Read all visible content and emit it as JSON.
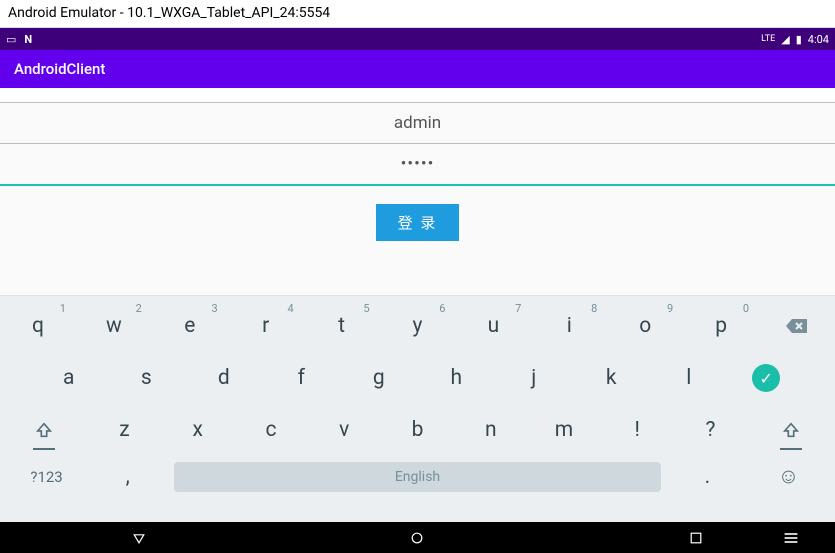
{
  "window": {
    "title": "Android Emulator - 10.1_WXGA_Tablet_API_24:5554"
  },
  "status": {
    "left_icons": [
      "card-icon",
      "n-icon"
    ],
    "right": {
      "signal": "LTE",
      "battery": "▮",
      "time": "4:04"
    }
  },
  "actionbar": {
    "title": "AndroidClient"
  },
  "form": {
    "username": {
      "value": "admin",
      "placeholder": ""
    },
    "password": {
      "value": "•••••",
      "placeholder": ""
    },
    "login_label": "登 录"
  },
  "keyboard": {
    "row1": [
      {
        "main": "q",
        "sup": "1"
      },
      {
        "main": "w",
        "sup": "2"
      },
      {
        "main": "e",
        "sup": "3"
      },
      {
        "main": "r",
        "sup": "4"
      },
      {
        "main": "t",
        "sup": "5"
      },
      {
        "main": "y",
        "sup": "6"
      },
      {
        "main": "u",
        "sup": "7"
      },
      {
        "main": "i",
        "sup": "8"
      },
      {
        "main": "o",
        "sup": "9"
      },
      {
        "main": "p",
        "sup": "0"
      }
    ],
    "row2": [
      {
        "main": "a"
      },
      {
        "main": "s"
      },
      {
        "main": "d"
      },
      {
        "main": "f"
      },
      {
        "main": "g"
      },
      {
        "main": "h"
      },
      {
        "main": "j"
      },
      {
        "main": "k"
      },
      {
        "main": "l"
      }
    ],
    "row3_letters": [
      {
        "main": "z"
      },
      {
        "main": "x"
      },
      {
        "main": "c"
      },
      {
        "main": "v"
      },
      {
        "main": "b"
      },
      {
        "main": "n"
      },
      {
        "main": "m"
      },
      {
        "main": "!"
      },
      {
        "main": "?"
      }
    ],
    "bottom": {
      "symbols": "?123",
      "comma": ",",
      "space": "English",
      "period": "."
    }
  }
}
